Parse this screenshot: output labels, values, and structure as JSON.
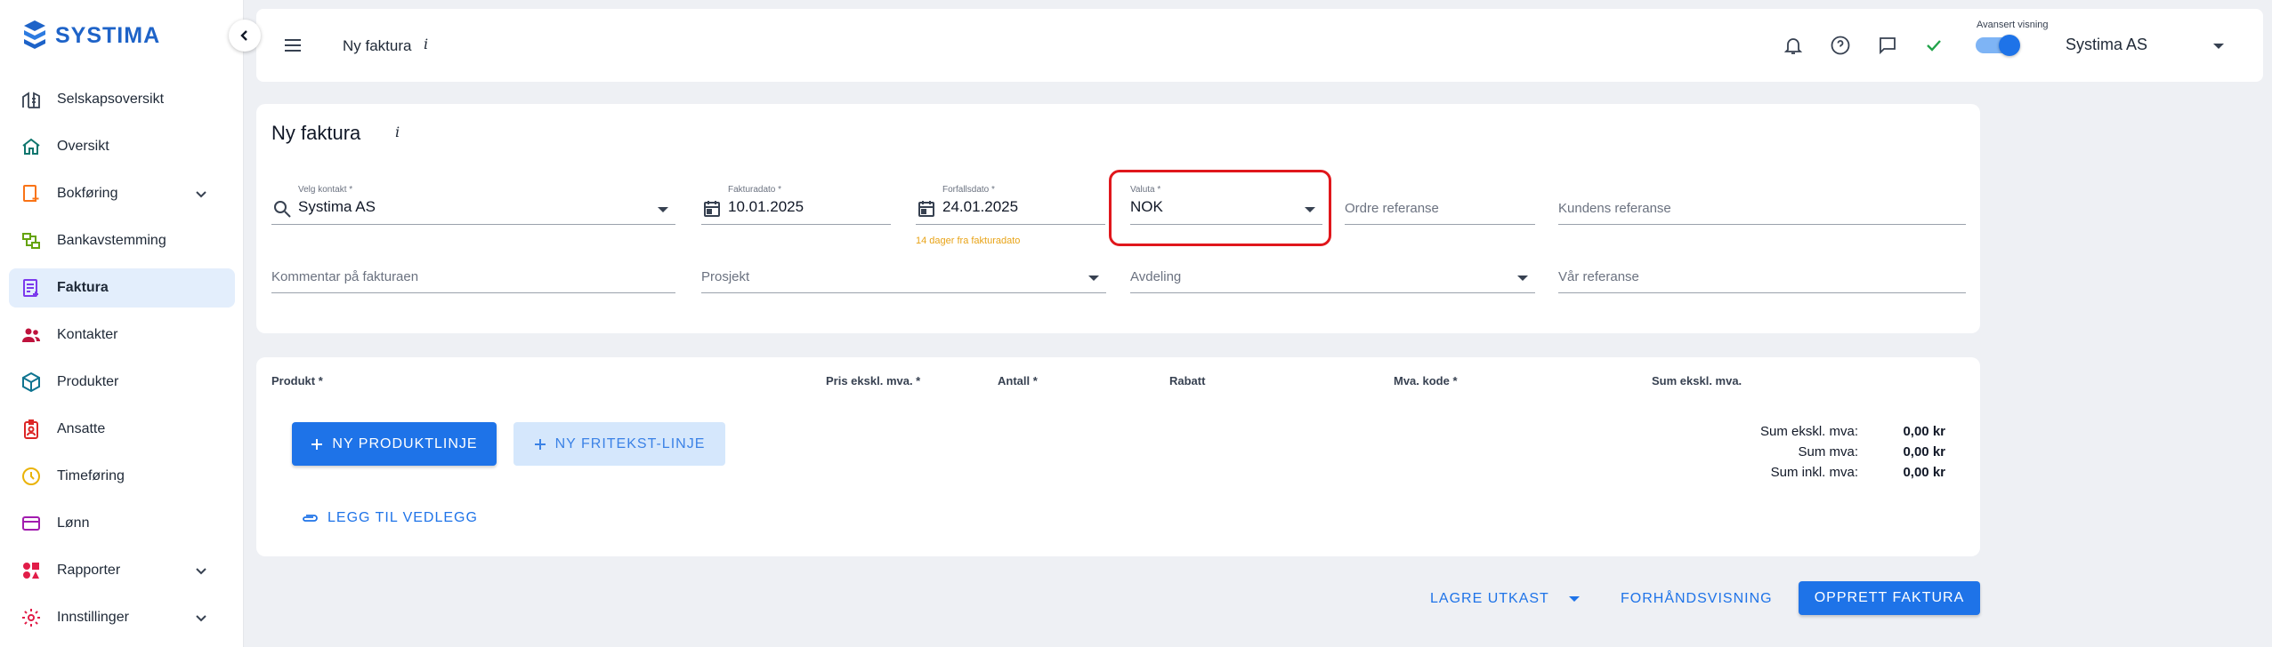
{
  "app": {
    "logo_text": "SYSTIMA"
  },
  "sidebar": {
    "items": [
      {
        "label": "Selskapsoversikt",
        "icon": "company-overview-icon",
        "color": "#374151"
      },
      {
        "label": "Oversikt",
        "icon": "home-icon",
        "color": "#0f766e"
      },
      {
        "label": "Bokføring",
        "icon": "accounting-icon",
        "color": "#f97316",
        "expandable": true
      },
      {
        "label": "Bankavstemming",
        "icon": "bank-reconcile-icon",
        "color": "#65a30d"
      },
      {
        "label": "Faktura",
        "icon": "invoice-icon",
        "color": "#7c3aed",
        "active": true
      },
      {
        "label": "Kontakter",
        "icon": "contacts-icon",
        "color": "#be123c"
      },
      {
        "label": "Produkter",
        "icon": "products-icon",
        "color": "#0e7490"
      },
      {
        "label": "Ansatte",
        "icon": "employees-icon",
        "color": "#dc2626"
      },
      {
        "label": "Timeføring",
        "icon": "clock-icon",
        "color": "#eab308"
      },
      {
        "label": "Lønn",
        "icon": "payroll-icon",
        "color": "#a21caf"
      },
      {
        "label": "Rapporter",
        "icon": "reports-icon",
        "color": "#e11d48",
        "expandable": true
      },
      {
        "label": "Innstillinger",
        "icon": "settings-icon",
        "color": "#e11d48",
        "expandable": true
      }
    ]
  },
  "topbar": {
    "title": "Ny faktura",
    "info": "i",
    "advanced_view_label": "Avansert visning",
    "advanced_view_on": true,
    "company": "Systima AS"
  },
  "form": {
    "title": "Ny faktura",
    "info": "i",
    "contact": {
      "label": "Velg kontakt *",
      "value": "Systima AS"
    },
    "invoice_date": {
      "label": "Fakturadato *",
      "value": "10.01.2025"
    },
    "due_date": {
      "label": "Forfallsdato *",
      "value": "24.01.2025",
      "helper": "14 dager fra fakturadato"
    },
    "currency": {
      "label": "Valuta *",
      "value": "NOK"
    },
    "order_ref": {
      "placeholder": "Ordre referanse"
    },
    "customer_ref": {
      "placeholder": "Kundens referanse"
    },
    "comment": {
      "placeholder": "Kommentar på fakturaen"
    },
    "project": {
      "placeholder": "Prosjekt"
    },
    "department": {
      "placeholder": "Avdeling"
    },
    "our_ref": {
      "placeholder": "Vår referanse"
    }
  },
  "lines": {
    "columns": [
      "Produkt *",
      "Pris ekskl. mva. *",
      "Antall *",
      "Rabatt",
      "Mva. kode *",
      "Sum ekskl. mva."
    ],
    "new_product_line": "NY PRODUKTLINJE",
    "new_free_line": "NY FRITEKST-LINJE",
    "add_attachment": "LEGG TIL VEDLEGG",
    "totals": [
      {
        "label": "Sum ekskl. mva:",
        "value": "0,00 kr"
      },
      {
        "label": "Sum mva:",
        "value": "0,00 kr"
      },
      {
        "label": "Sum inkl. mva:",
        "value": "0,00 kr"
      }
    ]
  },
  "actions": {
    "save_draft": "LAGRE UTKAST",
    "preview": "FORHÅNDSVISNING",
    "create": "OPPRETT FAKTURA"
  },
  "colors": {
    "primary": "#1e73e8",
    "highlight": "#e0171c",
    "helper": "#e8a317"
  }
}
